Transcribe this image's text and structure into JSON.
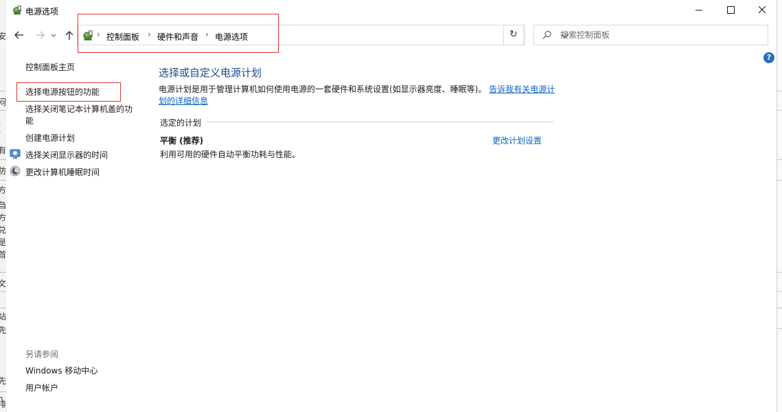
{
  "window": {
    "title": "电源选项"
  },
  "breadcrumb": [
    {
      "label": "控制面板"
    },
    {
      "label": "硬件和声音"
    },
    {
      "label": "电源选项"
    }
  ],
  "search": {
    "placeholder": "搜索控制面板"
  },
  "sidebar": {
    "home": "控制面板主页",
    "items": [
      {
        "label": "选择电源按钮的功能"
      },
      {
        "label": "选择关闭笔记本计算机盖的功"
      },
      {
        "label": "能"
      },
      {
        "label": "创建电源计划"
      },
      {
        "label": "选择关闭显示器的时间"
      },
      {
        "label": "更改计算机睡眠时间"
      }
    ],
    "see_also": {
      "heading": "另请参阅",
      "items": [
        {
          "label": "Windows 移动中心"
        },
        {
          "label": "用户帐户"
        }
      ]
    }
  },
  "main": {
    "heading": "选择或自定义电源计划",
    "description": "电源计划是用于管理计算机如何使用电源的一套硬件和系统设置(如显示器亮度、睡眠等)。",
    "description_link_1": "告诉我有关电源计",
    "description_link_2": "划的详细信息",
    "section_heading": "选定的计划",
    "plan": {
      "name": "平衡 (推荐)",
      "description": "利用可用的硬件自动平衡功耗与性能。",
      "change_link": "更改计划设置"
    }
  },
  "background_fragments": [
    "安",
    "闷",
    "(",
    "有",
    "防",
    "方",
    "刍",
    "方",
    "兑",
    "是",
    "首",
    "文",
    "站",
    "先",
    "先",
    "n",
    "排"
  ],
  "colors": {
    "link": "#0b62c4",
    "heading": "#1b4a8a",
    "annotation": "#e0302e",
    "help": "#2a6ebd"
  }
}
